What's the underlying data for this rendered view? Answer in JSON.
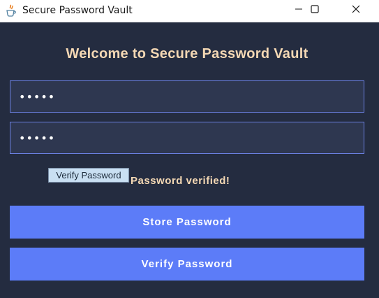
{
  "window": {
    "title": "Secure Password Vault",
    "icon": "java-cup-icon"
  },
  "titlebar": {
    "minimize_icon": "minimize-icon",
    "maximize_icon": "maximize-icon",
    "close_icon": "close-icon"
  },
  "main": {
    "heading": "Welcome to Secure Password Vault",
    "password_field_1": {
      "value": "•••••"
    },
    "password_field_2": {
      "value": "•••••"
    },
    "small_verify_button": "Verify Password",
    "status_message": "Password verified!",
    "store_button": "Store Password",
    "verify_button": "Verify Password"
  },
  "colors": {
    "background": "#242c40",
    "field_background": "#2e3750",
    "field_border": "#6a7fe0",
    "accent_button": "#5c7cf8",
    "heading_text": "#f4d8b4"
  }
}
